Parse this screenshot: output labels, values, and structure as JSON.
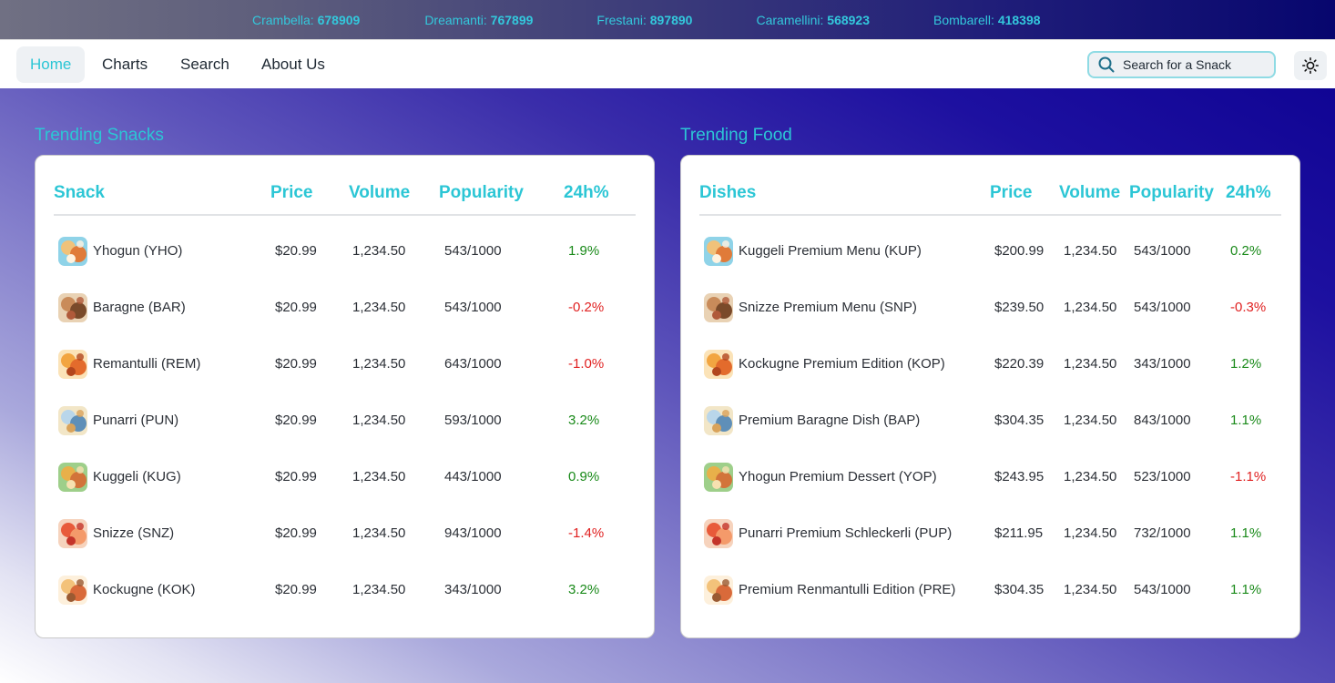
{
  "ticker": [
    {
      "name": "Crambella:",
      "value": "678909"
    },
    {
      "name": "Dreamanti:",
      "value": "767899"
    },
    {
      "name": "Frestani:",
      "value": "897890"
    },
    {
      "name": "Caramellini:",
      "value": "568923"
    },
    {
      "name": "Bombarell:",
      "value": "418398"
    }
  ],
  "nav": {
    "home": "Home",
    "charts": "Charts",
    "search": "Search",
    "about": "About Us",
    "search_placeholder": "Search for a Snack",
    "theme_icon": "sun-icon"
  },
  "colors": {
    "accent": "#2cc6d5",
    "positive": "#1a8a1a",
    "negative": "#e02020"
  },
  "snacks": {
    "title": "Trending Snacks",
    "headers": [
      "Snack",
      "Price",
      "Volume",
      "Popularity",
      "24h%"
    ],
    "rows": [
      {
        "name": "Yhogun (YHO)",
        "price": "$20.99",
        "volume": "1,234.50",
        "popularity": "543/1000",
        "change": "1.9%"
      },
      {
        "name": "Baragne (BAR)",
        "price": "$20.99",
        "volume": "1,234.50",
        "popularity": "543/1000",
        "change": "-0.2%"
      },
      {
        "name": "Remantulli (REM)",
        "price": "$20.99",
        "volume": "1,234.50",
        "popularity": "643/1000",
        "change": "-1.0%"
      },
      {
        "name": "Punarri (PUN)",
        "price": "$20.99",
        "volume": "1,234.50",
        "popularity": "593/1000",
        "change": "3.2%"
      },
      {
        "name": "Kuggeli (KUG)",
        "price": "$20.99",
        "volume": "1,234.50",
        "popularity": "443/1000",
        "change": "0.9%"
      },
      {
        "name": "Snizze (SNZ)",
        "price": "$20.99",
        "volume": "1,234.50",
        "popularity": "943/1000",
        "change": "-1.4%"
      },
      {
        "name": "Kockugne (KOK)",
        "price": "$20.99",
        "volume": "1,234.50",
        "popularity": "343/1000",
        "change": "3.2%"
      }
    ]
  },
  "food": {
    "title": "Trending Food",
    "headers": [
      "Dishes",
      "Price",
      "Volume",
      "Popularity",
      "24h%"
    ],
    "rows": [
      {
        "name": "Kuggeli Premium Menu (KUP)",
        "price": "$200.99",
        "volume": "1,234.50",
        "popularity": "543/1000",
        "change": "0.2%"
      },
      {
        "name": "Snizze Premium Menu (SNP)",
        "price": "$239.50",
        "volume": "1,234.50",
        "popularity": "543/1000",
        "change": "-0.3%"
      },
      {
        "name": "Kockugne Premium Edition (KOP)",
        "price": "$220.39",
        "volume": "1,234.50",
        "popularity": "343/1000",
        "change": "1.2%"
      },
      {
        "name": "Premium Baragne Dish (BAP)",
        "price": "$304.35",
        "volume": "1,234.50",
        "popularity": "843/1000",
        "change": "1.1%"
      },
      {
        "name": "Yhogun Premium Dessert (YOP)",
        "price": "$243.95",
        "volume": "1,234.50",
        "popularity": "523/1000",
        "change": "-1.1%"
      },
      {
        "name": "Punarri Premium Schleckerli (PUP)",
        "price": "$211.95",
        "volume": "1,234.50",
        "popularity": "732/1000",
        "change": "1.1%"
      },
      {
        "name": "Premium Renmantulli Edition (PRE)",
        "price": "$304.35",
        "volume": "1,234.50",
        "popularity": "543/1000",
        "change": "1.1%"
      }
    ]
  }
}
